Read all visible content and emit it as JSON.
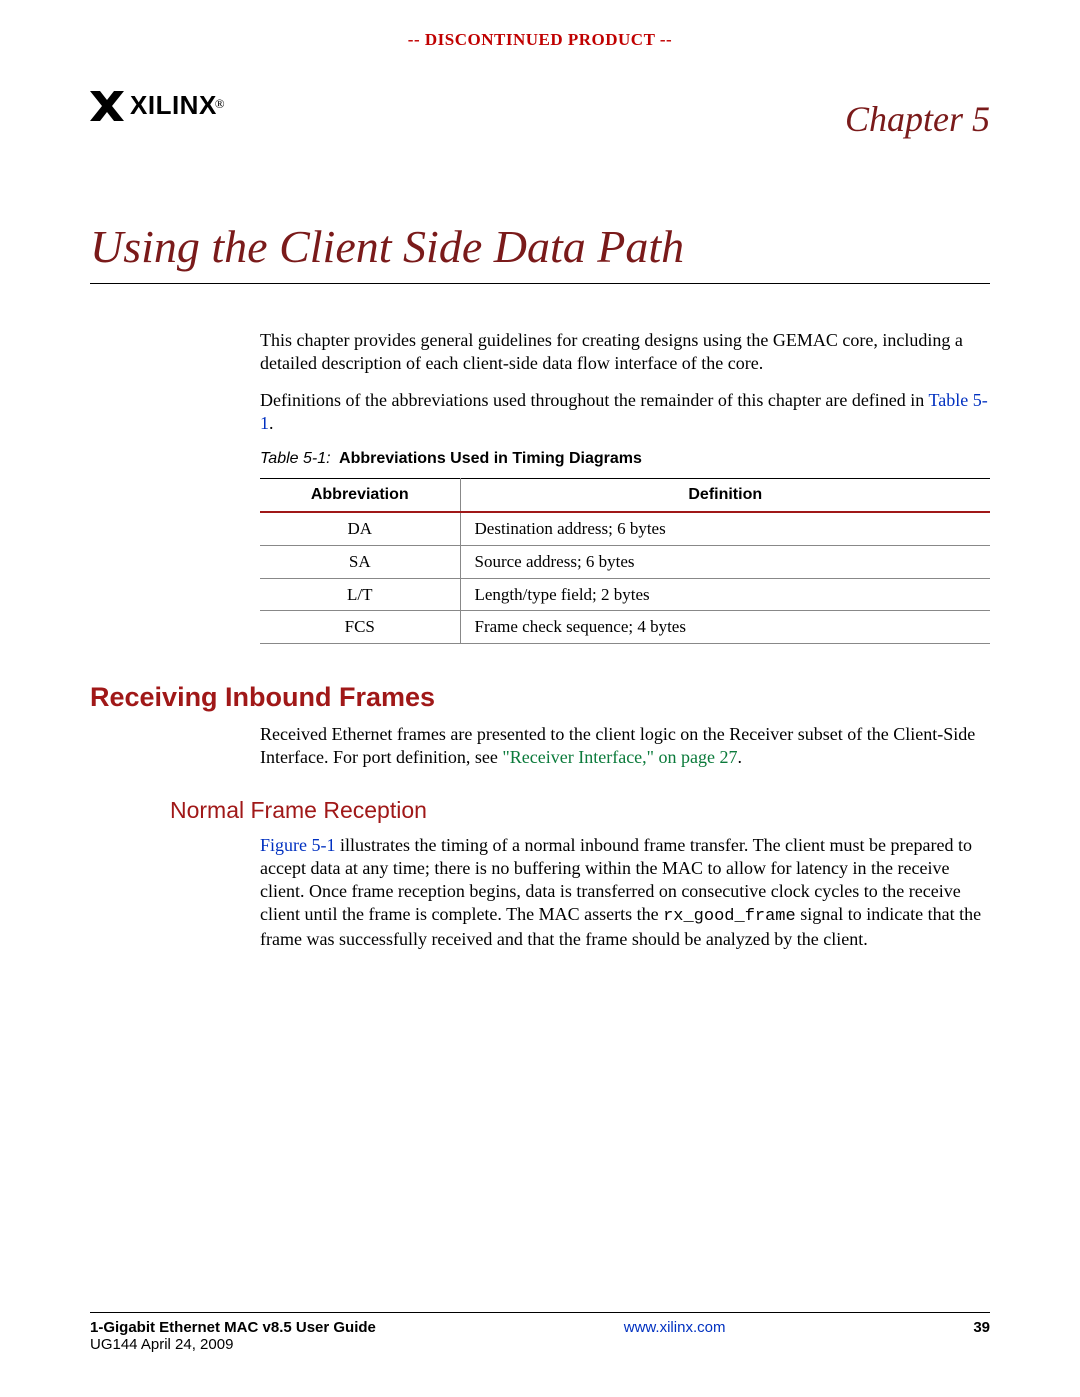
{
  "banner": "-- DISCONTINUED PRODUCT --",
  "logo": {
    "text": "XILINX",
    "reg": "®"
  },
  "chapter_label": "Chapter 5",
  "chapter_title": "Using the Client Side Data Path",
  "intro_p1": "This chapter provides general guidelines for creating designs using the GEMAC core, including a detailed description of each client-side data flow interface of the core.",
  "intro_p2a": "Definitions of the abbreviations used throughout the remainder of this chapter are defined in ",
  "intro_p2_link": "Table 5-1",
  "intro_p2b": ".",
  "table_caption_prefix": "Table 5-1:",
  "table_caption_title": "Abbreviations Used in Timing Diagrams",
  "table": {
    "headers": {
      "c1": "Abbreviation",
      "c2": "Definition"
    },
    "rows": [
      {
        "abbr": "DA",
        "def": "Destination address; 6 bytes"
      },
      {
        "abbr": "SA",
        "def": "Source address; 6 bytes"
      },
      {
        "abbr": "L/T",
        "def": "Length/type field; 2 bytes"
      },
      {
        "abbr": "FCS",
        "def": "Frame check sequence; 4 bytes"
      }
    ]
  },
  "h2_receiving": "Receiving Inbound Frames",
  "recv_p1a": "Received Ethernet frames are presented to the client logic on the Receiver subset of the Client-Side Interface. For port definition, see ",
  "recv_p1_link": "\"Receiver Interface,\" on page 27",
  "recv_p1b": ".",
  "h3_normal": "Normal Frame Reception",
  "normal_link": "Figure 5-1",
  "normal_p_a": " illustrates the timing of a normal inbound frame transfer. The client must be prepared to accept data at any time; there is no buffering within the MAC to allow for latency in the receive client. Once frame reception begins, data is transferred on consecutive clock cycles to the receive client until the frame is complete. The MAC asserts the ",
  "normal_sig": "rx_good_frame",
  "normal_p_b": " signal to indicate that the frame was successfully received and that the frame should be analyzed by the client.",
  "footer": {
    "guide": "1-Gigabit Ethernet MAC v8.5 User Guide",
    "date": "UG144 April 24, 2009",
    "url": "www.xilinx.com",
    "page": "39"
  }
}
